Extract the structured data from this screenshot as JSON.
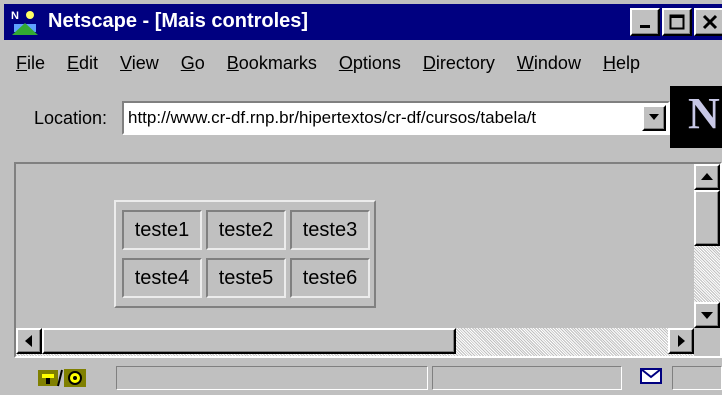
{
  "window": {
    "title": "Netscape - [Mais controles]",
    "minimize_icon": "minimize-icon",
    "maximize_icon": "maximize-icon",
    "close_icon": "close-icon"
  },
  "menu": [
    {
      "label": "File",
      "underline": "F"
    },
    {
      "label": "Edit",
      "underline": "E"
    },
    {
      "label": "View",
      "underline": "V"
    },
    {
      "label": "Go",
      "underline": "G"
    },
    {
      "label": "Bookmarks",
      "underline": "B"
    },
    {
      "label": "Options",
      "underline": "O"
    },
    {
      "label": "Directory",
      "underline": "D"
    },
    {
      "label": "Window",
      "underline": "W"
    },
    {
      "label": "Help",
      "underline": "H"
    }
  ],
  "location": {
    "label": "Location:",
    "value": "http://www.cr-df.rnp.br/hipertextos/cr-df/cursos/tabela/t"
  },
  "logo": "N",
  "table": {
    "rows": [
      [
        "teste1",
        "teste2",
        "teste3"
      ],
      [
        "teste4",
        "teste5",
        "teste6"
      ]
    ]
  },
  "icons": {
    "security": "security-key-icon",
    "mail": "mail-icon"
  }
}
